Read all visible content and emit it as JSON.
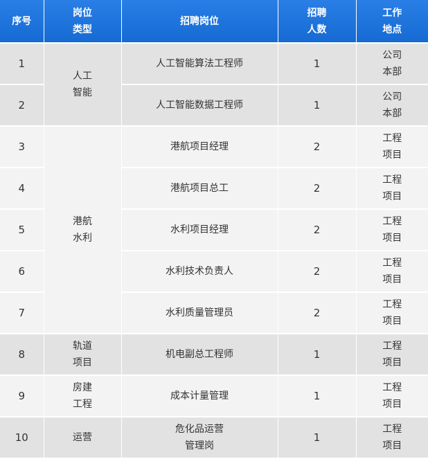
{
  "header": {
    "index": "序号",
    "category_line1": "岗位",
    "category_line2": "类型",
    "position": "招聘岗位",
    "count_line1": "招聘",
    "count_line2": "人数",
    "location_line1": "工作",
    "location_line2": "地点"
  },
  "categories": {
    "ai_line1": "人工",
    "ai_line2": "智能",
    "port_line1": "港航",
    "port_line2": "水利",
    "rail_line1": "轨道",
    "rail_line2": "项目",
    "building_line1": "房建",
    "building_line2": "工程",
    "ops": "运营"
  },
  "rows": [
    {
      "index": "1",
      "position": "人工智能算法工程师",
      "count": "1",
      "location_line1": "公司",
      "location_line2": "本部"
    },
    {
      "index": "2",
      "position": "人工智能数据工程师",
      "count": "1",
      "location_line1": "公司",
      "location_line2": "本部"
    },
    {
      "index": "3",
      "position": "港航项目经理",
      "count": "2",
      "location_line1": "工程",
      "location_line2": "项目"
    },
    {
      "index": "4",
      "position": "港航项目总工",
      "count": "2",
      "location_line1": "工程",
      "location_line2": "项目"
    },
    {
      "index": "5",
      "position": "水利项目经理",
      "count": "2",
      "location_line1": "工程",
      "location_line2": "项目"
    },
    {
      "index": "6",
      "position": "水利技术负责人",
      "count": "2",
      "location_line1": "工程",
      "location_line2": "项目"
    },
    {
      "index": "7",
      "position": "水利质量管理员",
      "count": "2",
      "location_line1": "工程",
      "location_line2": "项目"
    },
    {
      "index": "8",
      "position": "机电副总工程师",
      "count": "1",
      "location_line1": "工程",
      "location_line2": "项目"
    },
    {
      "index": "9",
      "position": "成本计量管理",
      "count": "1",
      "location_line1": "工程",
      "location_line2": "项目"
    },
    {
      "index": "10",
      "position_line1": "危化品运营",
      "position_line2": "管理岗",
      "count": "1",
      "location_line1": "工程",
      "location_line2": "项目"
    }
  ]
}
